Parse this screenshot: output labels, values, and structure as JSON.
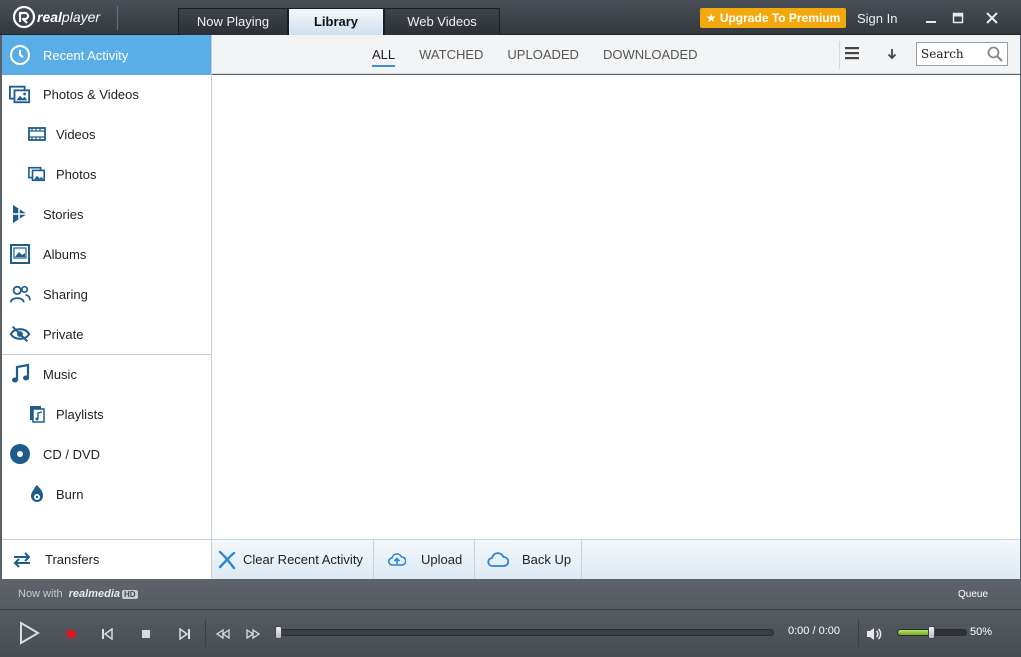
{
  "app": {
    "logo_text_bold": "real",
    "logo_text": "player"
  },
  "tabs": [
    {
      "label": "Now Playing",
      "active": false
    },
    {
      "label": "Library",
      "active": true
    },
    {
      "label": "Web Videos",
      "active": false
    }
  ],
  "header": {
    "upgrade_label": "Upgrade To Premium",
    "signin_label": "Sign In"
  },
  "sidebar": {
    "items": [
      {
        "label": "Recent Activity",
        "icon": "clock-icon",
        "active": true
      },
      {
        "label": "Photos & Videos",
        "icon": "photos-videos-icon"
      },
      {
        "label": "Videos",
        "icon": "film-icon"
      },
      {
        "label": "Photos",
        "icon": "photo-icon"
      },
      {
        "label": "Stories",
        "icon": "stories-icon"
      },
      {
        "label": "Albums",
        "icon": "album-icon"
      },
      {
        "label": "Sharing",
        "icon": "people-icon"
      },
      {
        "label": "Private",
        "icon": "eye-slash-icon"
      },
      {
        "label": "Music",
        "icon": "music-note-icon"
      },
      {
        "label": "Playlists",
        "icon": "playlist-icon"
      },
      {
        "label": "CD / DVD",
        "icon": "disc-icon"
      },
      {
        "label": "Burn",
        "icon": "burn-icon"
      }
    ],
    "transfers_label": "Transfers"
  },
  "filters": [
    {
      "label": "ALL",
      "active": true
    },
    {
      "label": "WATCHED",
      "active": false
    },
    {
      "label": "UPLOADED",
      "active": false
    },
    {
      "label": "DOWNLOADED",
      "active": false
    }
  ],
  "search": {
    "placeholder": "Search"
  },
  "actions": {
    "clear_label": "Clear Recent Activity",
    "upload_label": "Upload",
    "backup_label": "Back Up"
  },
  "player": {
    "now_with": "Now with",
    "realmedia_text": "realmedia",
    "hd_badge": "HD",
    "queue_label": "Queue",
    "time": "0:00 / 0:00",
    "volume_percent": 50,
    "volume_label": "50%",
    "seek_fraction": 0
  },
  "colors": {
    "accent": "#5aaee8",
    "upgrade": "#f3a90e",
    "icon": "#1e5c8c"
  }
}
